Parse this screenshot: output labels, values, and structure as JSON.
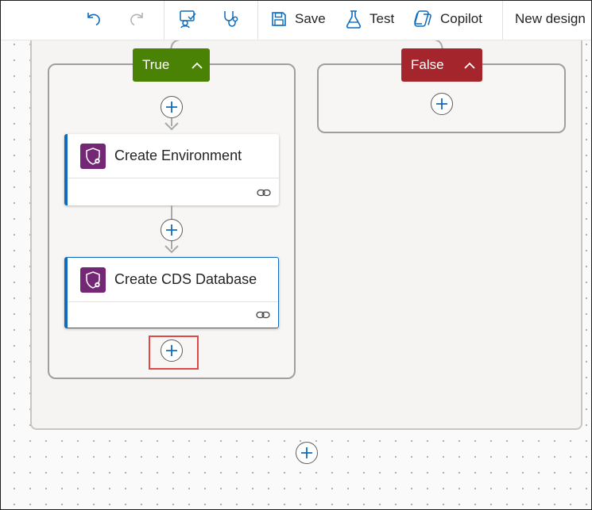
{
  "toolbar": {
    "undo_icon": "undo-icon",
    "redo_icon": "redo-icon",
    "save_label": "Save",
    "test_label": "Test",
    "copilot_label": "Copilot",
    "new_designer_label": "New design"
  },
  "condition": {
    "true_branch": {
      "label": "True"
    },
    "false_branch": {
      "label": "False"
    }
  },
  "actions": [
    {
      "title": "Create Environment",
      "icon": "admin-shield-icon"
    },
    {
      "title": "Create CDS Database",
      "icon": "admin-shield-icon"
    }
  ],
  "colors": {
    "true_green": "#498205",
    "false_red": "#a4262c",
    "accent_blue": "#0f6cbd",
    "connector_purple": "#742774",
    "highlight_red": "#e04848"
  }
}
